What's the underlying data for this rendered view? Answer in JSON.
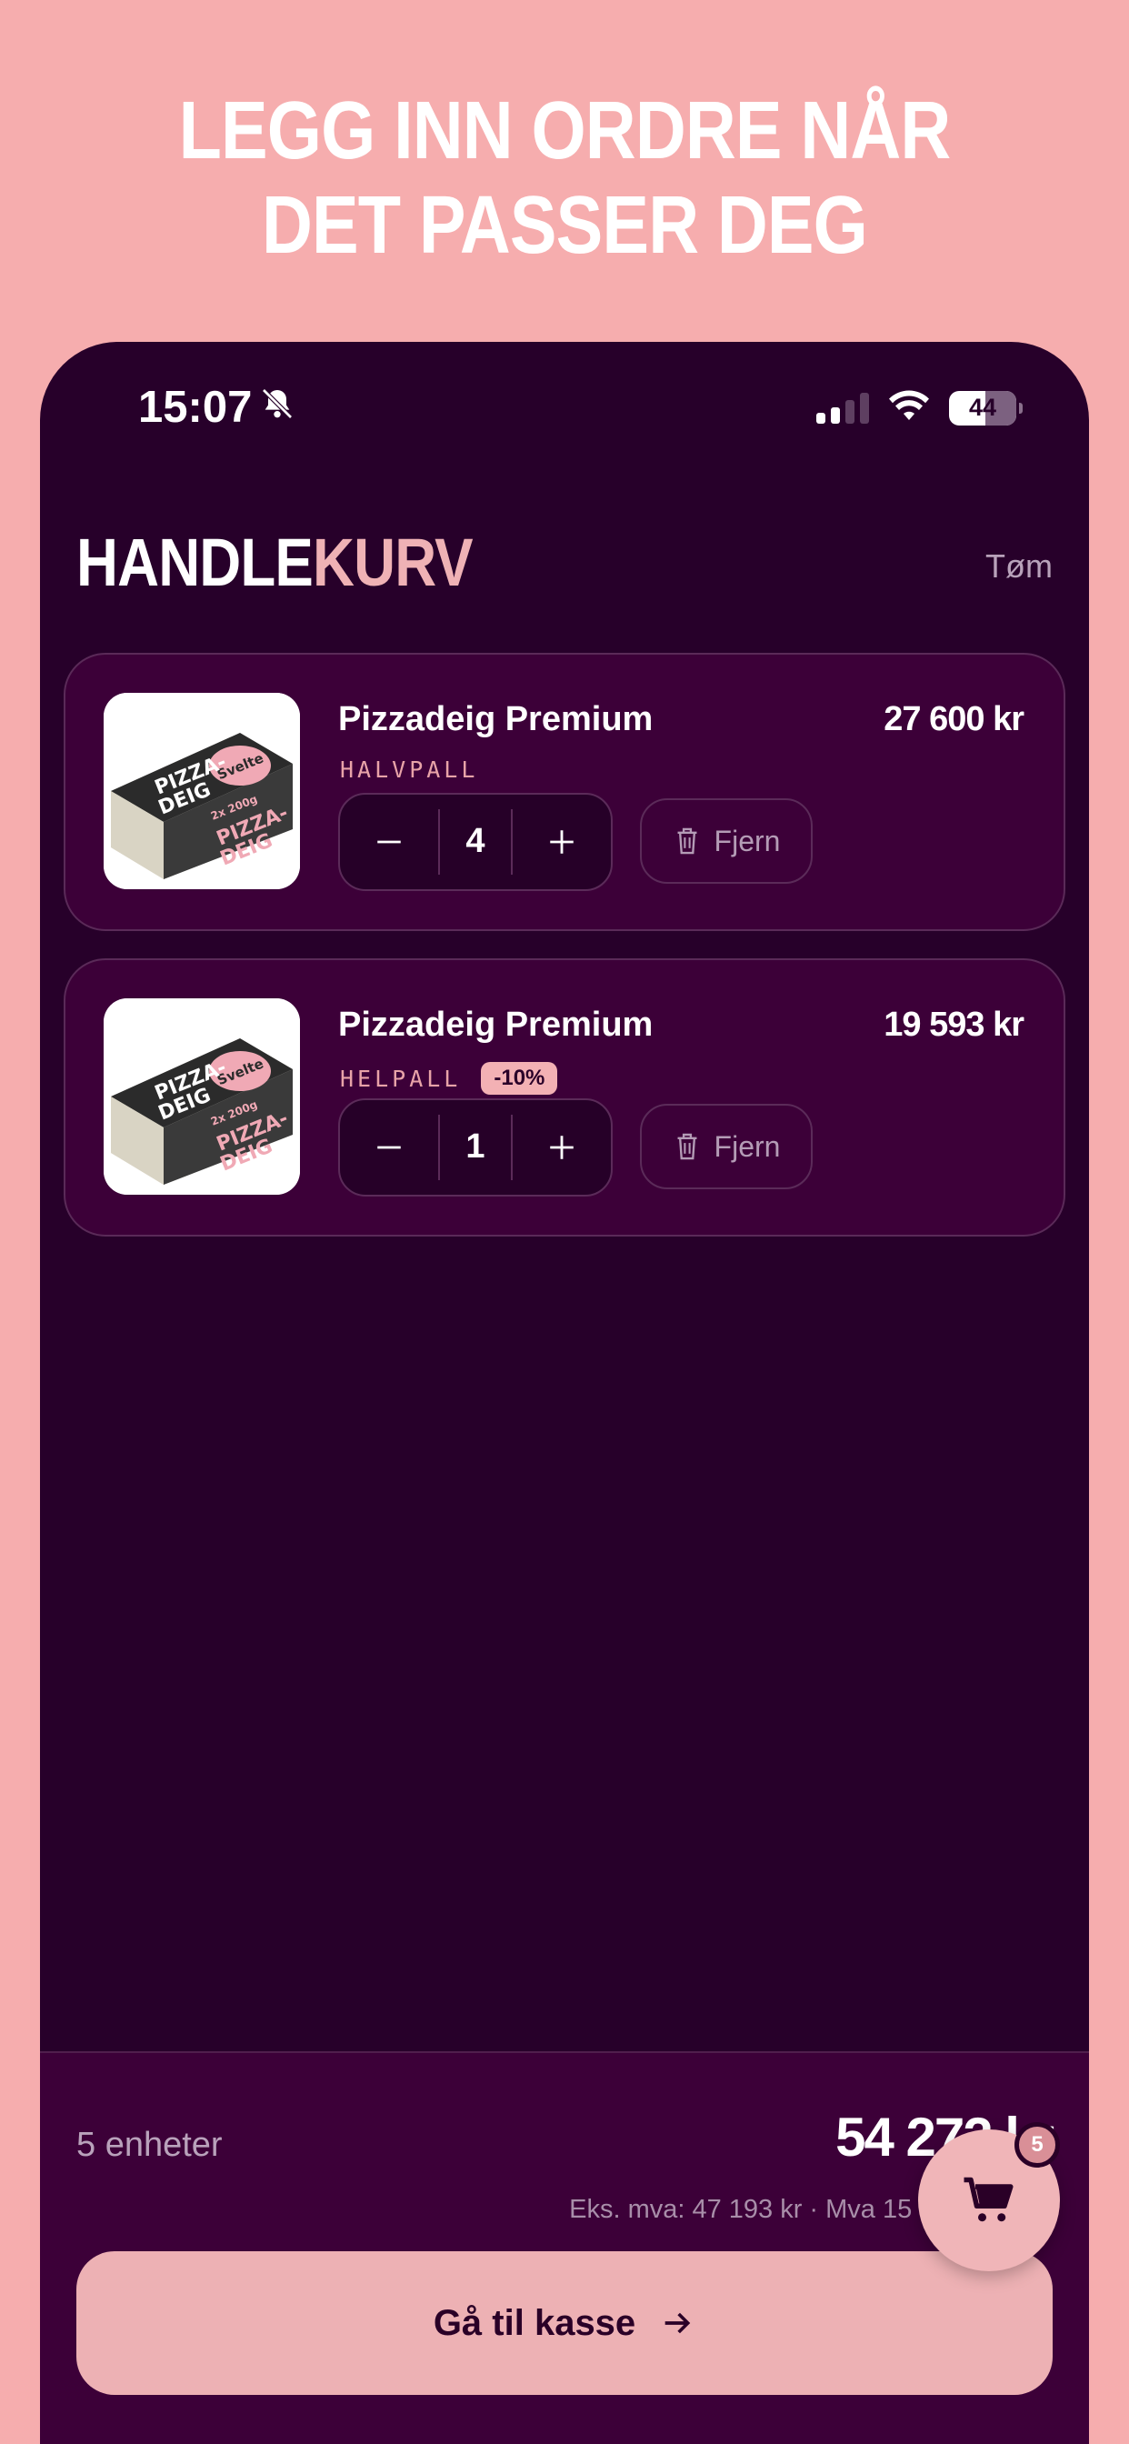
{
  "promo": {
    "headline_line1": "LEGG INN ORDRE NÅR",
    "headline_line2": "DET PASSER DEG"
  },
  "status_bar": {
    "time": "15:07",
    "battery": "44",
    "icons": [
      "bell-slash-icon",
      "signal-icon",
      "wifi-icon",
      "battery-icon"
    ]
  },
  "header": {
    "title_part1": "HANDLE",
    "title_part2": "KURV",
    "clear_label": "Tøm"
  },
  "cart": {
    "items": [
      {
        "name": "Pizzadeig Premium",
        "variant": "HALVPALL",
        "price": "27 600 kr",
        "quantity": "4",
        "remove_label": "Fjern",
        "discount": ""
      },
      {
        "name": "Pizzadeig Premium",
        "variant": "HELPALL",
        "price": "19 593 kr",
        "quantity": "1",
        "remove_label": "Fjern",
        "discount": "-10%"
      }
    ],
    "product_packaging": {
      "brand": "Svelte",
      "label_line1": "PIZZA-",
      "label_line2": "DEIG",
      "count_text": "2x 200g"
    }
  },
  "summary": {
    "units": "5 enheter",
    "total": "54 272 kr",
    "tax_breakdown": "Eks. mva: 47 193 kr · Mva 15 %: 7 079 kr",
    "checkout_label": "Gå til kasse",
    "cart_badge": "5"
  },
  "colors": {
    "background": "#f6adae",
    "app_background": "#27002a",
    "card": "#3c0038",
    "accent": "#efb2b5"
  }
}
